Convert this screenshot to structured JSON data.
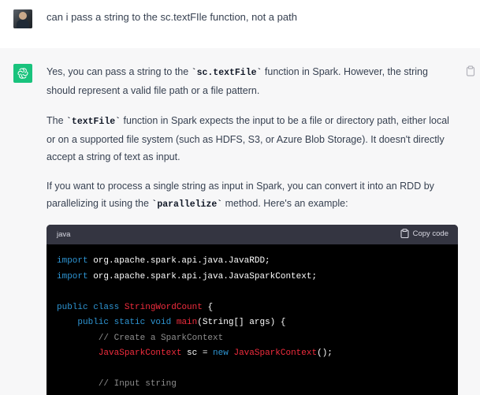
{
  "user_message": {
    "text": "can i pass a string to the sc.textFIle function, not a path"
  },
  "assistant": {
    "p1": {
      "a": "Yes, you can pass a string to the ",
      "code": "sc.textFile",
      "b": " function in Spark. However, the string",
      "c": "should represent a valid file path or a file pattern."
    },
    "p2": {
      "a": "The ",
      "code": "textFile",
      "b": " function in Spark expects the input to be a file or directory path, either local",
      "c": "or on a supported file system (such as HDFS, S3, or Azure Blob Storage). It doesn't directly",
      "d": "accept a string of text as input."
    },
    "p3": {
      "a": "If you want to process a single string as input in Spark, you can convert it into an RDD by",
      "b": "parallelizing it using the ",
      "code": "parallelize",
      "c": " method. Here's an example:"
    }
  },
  "code_block": {
    "language": "java",
    "copy_label": "Copy code",
    "lines": {
      "l1_kw": "import",
      "l1_rest": " org.apache.spark.api.java.JavaRDD;",
      "l2_kw": "import",
      "l2_rest": " org.apache.spark.api.java.JavaSparkContext;",
      "l4_kw": "public class",
      "l4_name": "StringWordCount",
      "l4_rest": " {",
      "l5_kw": "public static void",
      "l5_name": "main",
      "l5_rest": "(String[] args) {",
      "l6_comment": "// Create a SparkContext",
      "l7_type": "JavaSparkContext",
      "l7_mid": " sc = ",
      "l7_kw": "new",
      "l7_ctor": "JavaSparkContext",
      "l7_end": "();",
      "l9_comment": "// Input string"
    }
  },
  "colors": {
    "gpt_green": "#19c37d",
    "keyword": "#2e95d3",
    "type": "#f22c3d",
    "comment": "#8e8e8e"
  },
  "icons": [
    "user-avatar",
    "chatgpt-logo-icon",
    "clipboard-icon"
  ]
}
